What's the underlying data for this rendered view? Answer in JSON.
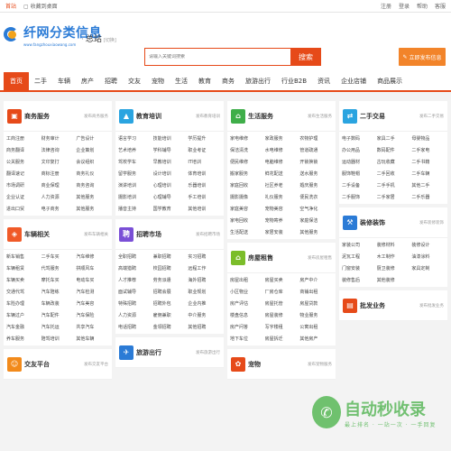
{
  "topbar": {
    "home": "首站",
    "bookmark": "收藏到桌面",
    "login": "注册",
    "register": "登录",
    "links": [
      "帮助",
      "客服"
    ]
  },
  "header": {
    "logo_name": "纤网分类信息",
    "logo_url": "www.fangzhouxiaowang.com",
    "site_label": "总站",
    "site_sub": "[切换]",
    "search_placeholder": "请输入关键词搜索",
    "search_button": "搜索",
    "publish_button": "立即发布信息"
  },
  "nav": [
    "首页",
    "二手",
    "车辆",
    "房产",
    "招聘",
    "交友",
    "宠物",
    "生活",
    "教育",
    "商务",
    "旅游出行",
    "行业B2B",
    "资讯",
    "企业店铺",
    "商品展示"
  ],
  "cards": {
    "business": {
      "title": "商务服务",
      "more": "发布商务服务",
      "items": [
        "工商注册",
        "财务审计",
        "广告设计",
        "商务翻译",
        "法律咨询",
        "企业策划",
        "公关服务",
        "文印复打",
        "会议组织",
        "翻译速记",
        "商标注册",
        "商务礼仪",
        "市场调研",
        "商业保理",
        "商务咨询",
        "企业认证",
        "人力资源",
        "其他服务",
        "进出口贸",
        "电子商务",
        "其他服务"
      ]
    },
    "education": {
      "title": "教育培训",
      "more": "发布教育培训",
      "items": [
        "语言学习",
        "技能培训",
        "学历提升",
        "艺术培养",
        "学科辅导",
        "职业考证",
        "驾校学车",
        "早教培训",
        "IT培训",
        "留学服务",
        "设计培训",
        "体育培训",
        "演讲培训",
        "心理培训",
        "乐器培训",
        "摄影培训",
        "心理辅导",
        "手工培训",
        "播音主持",
        "国学教育",
        "其他培训"
      ]
    },
    "life": {
      "title": "生活服务",
      "more": "发布生活服务",
      "items": [
        "家电维修",
        "家政服务",
        "农物护理",
        "保洁清洗",
        "水电维修",
        "管道疏通",
        "便民维修",
        "电脑维修",
        "开锁换锁",
        "搬家服务",
        "鲜花配送",
        "送水服务",
        "家庭回收",
        "社区养老",
        "婚庆服务",
        "摄影摄像",
        "礼仪服务",
        "便民洗衣",
        "家庭美容",
        "宠物美容",
        "空气净化",
        "家电回收",
        "宠物寄养",
        "家庭保洁",
        "生活配送",
        "家居安装",
        "其他服务"
      ]
    },
    "secondhand": {
      "title": "二手交易",
      "more": "发布二手交易",
      "items": [
        "电子数码",
        "家具二手",
        "母婴物品",
        "办公用品",
        "数码配件",
        "二手家电",
        "运动器材",
        "古玩收藏",
        "二手书籍",
        "服饰鞋帽",
        "二手回收",
        "二手车辆",
        "二手设备",
        "二手手机",
        "其他二手",
        "二手服饰",
        "二手家居",
        "二手乐器"
      ]
    },
    "vehicles": {
      "title": "车辆相关",
      "more": "发布车辆相关",
      "items": [
        "新车销售",
        "二手车买",
        "汽车维修",
        "车辆租赁",
        "代驾服务",
        "拼顺风车",
        "车辆买卖",
        "摩托车买",
        "电动车买",
        "交通代驾",
        "汽车陪练",
        "汽车检测",
        "车险办理",
        "车辆改装",
        "汽车美容",
        "车辆过户",
        "汽车配件",
        "汽车保险",
        "汽车金融",
        "汽车托运",
        "共享汽车",
        "养车服务",
        "陪驾培训",
        "其他车辆"
      ]
    },
    "jobs": {
      "title": "招聘市场",
      "more": "发布招聘市场",
      "items": [
        "全职招聘",
        "兼职招聘",
        "实习招聘",
        "高端猎聘",
        "校园招聘",
        "远程工作",
        "人才推荐",
        "劳务派遣",
        "海外招聘",
        "面试辅导",
        "招聘会展",
        "职业规划",
        "特殊招聘",
        "招聘外包",
        "企业内推",
        "人力资源",
        "雇佣兼职",
        "中介服务",
        "电话招聘",
        "金领招聘",
        "其他招聘"
      ]
    },
    "rental": {
      "title": "房屋租售",
      "more": "发布房屋租售",
      "items": [
        "房屋出租",
        "房屋买卖",
        "房产中介",
        "小区物业",
        "厂房仓库",
        "商铺出租",
        "房产评估",
        "房屋托管",
        "房屋贷款",
        "楼盘信息",
        "房屋装修",
        "物业服务",
        "房产问答",
        "写字楼租",
        "公寓出租",
        "地下车位",
        "房屋拆迁",
        "其他房产"
      ]
    },
    "decoration": {
      "title": "装修装饰",
      "more": "发布装修装饰",
      "items": [
        "家装公司",
        "装修材料",
        "装修设计",
        "泥瓦工程",
        "木工制作",
        "油漆涂料",
        "门窗安装",
        "厨卫装修",
        "家具定制",
        "装修售后",
        "其他装修"
      ]
    },
    "b2b": {
      "title": "批发业务",
      "more": "发布批发业务",
      "items": []
    },
    "dating": {
      "title": "交友平台",
      "more": "发布交友平台",
      "items": []
    },
    "travel": {
      "title": "旅游出行",
      "more": "发布旅游出行",
      "items": []
    },
    "pets": {
      "title": "宠物",
      "more": "发布宠物服务",
      "items": []
    }
  },
  "watermark": {
    "main": "自动秒收录",
    "sub": "最上排名 · 一站一次 · 一手回复"
  }
}
